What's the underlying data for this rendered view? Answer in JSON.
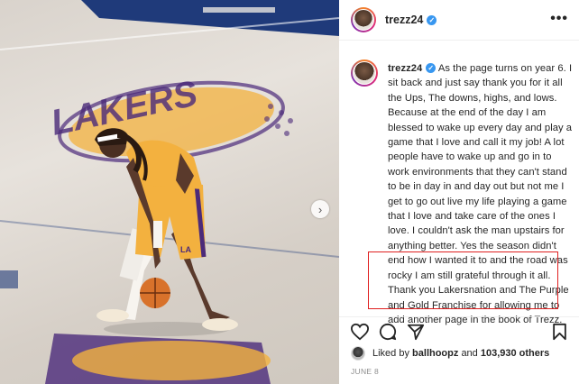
{
  "post": {
    "username": "trezz24",
    "verified": true,
    "caption": "As the page turns on year 6. I sit back and just say thank you for it all the Ups, The downs, highs, and lows. Because at the end of the day I am blessed to wake up every day and play a game that I love and call it my job! A lot people have to wake up and go in to work environments that they can't stand to be in day in and day out but not me I get to go out live my life playing a game that I love and take care of the ones I love. I couldn't ask the man upstairs for anything better. Yes the season didn't end how I wanted it to and the road was rocky I am still grateful through it all. Thank you Lakersnation and The Purple and Gold Franchise for allowing me to add another page in the book of Trezz.",
    "likes_prefix": "Liked by",
    "liked_by_user": "ballhoopz",
    "likes_and": "and",
    "others_count": "103,930 others",
    "date": "JUNE 8",
    "more_label": "•••"
  },
  "photo": {
    "court_text": "LAKERS",
    "jersey_text": "LA"
  },
  "icons": {
    "like": "heart-icon",
    "comment": "comment-icon",
    "share": "share-icon",
    "save": "bookmark-icon",
    "next": "chevron-right-icon"
  },
  "colors": {
    "verified": "#3897f0",
    "highlight": "#e02020",
    "lakers_gold": "#f3b13f",
    "lakers_purple": "#4b2a7a"
  }
}
